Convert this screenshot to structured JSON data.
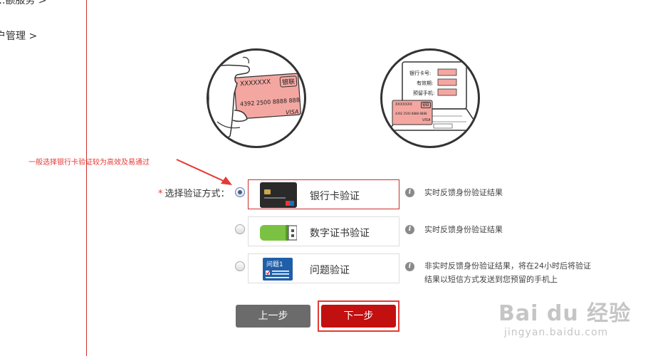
{
  "sidebar": {
    "items": [
      {
        "label": "...额服务 >"
      },
      {
        "label": "户管理 >"
      }
    ]
  },
  "illustrations": {
    "card": {
      "card_name": "XXXXXXX",
      "card_brand": "银联",
      "card_number": "4392 2500 8888 888",
      "card_network": "VISA"
    },
    "laptop": {
      "field_card_number": "银行卡号:",
      "field_expiry": "有效期:",
      "field_phone": "预留手机:",
      "card_name": "XXXXXXX",
      "card_brand": "银联",
      "card_number": "4392 2500 8888 8888",
      "card_network": "VISA"
    }
  },
  "annotation": {
    "text": "一般选择银行卡验证较为高效及易通过"
  },
  "form": {
    "required_mark": "*",
    "label": "选择验证方式：",
    "options": [
      {
        "label": "银行卡验证",
        "icon": "bank-card-icon",
        "selected": true,
        "description": "实时反馈身份验证结果"
      },
      {
        "label": "数字证书验证",
        "icon": "usb-key-icon",
        "selected": false,
        "description": "实时反馈身份验证结果"
      },
      {
        "label": "问题验证",
        "icon": "question-card-icon",
        "icon_text": "问题1",
        "selected": false,
        "description": "非实时反馈身份验证结果，将在24小时后将验证结果以短信方式发送到您预留的手机上"
      }
    ]
  },
  "buttons": {
    "prev": "上一步",
    "next": "下一步"
  },
  "watermark": {
    "main": "Bai du 经验",
    "sub": "jingyan.baidu.com"
  },
  "colors": {
    "accent_red": "#c20f0f",
    "annotation_red": "#e53935",
    "button_gray": "#6b6b6b"
  }
}
